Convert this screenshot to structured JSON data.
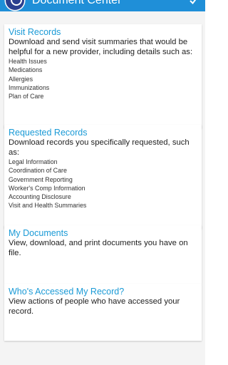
{
  "header": {
    "title": "Document Center",
    "logo_icon": "app-logo-icon",
    "action_icon": "check-icon",
    "background_color": "#1f8fd8"
  },
  "cards": [
    {
      "title": "Visit Records",
      "description": "Download and send visit summaries that would be helpful for a new provider, including details such as:",
      "items": [
        "Health Issues",
        "Medications",
        "Allergies",
        "Immunizations",
        "Plan of Care"
      ]
    },
    {
      "title": "Requested Records",
      "description": "Download records you specifically requested, such as:",
      "items": [
        "Legal Information",
        "Coordination of Care",
        "Government Reporting",
        "Worker's Comp Information",
        "Accounting Disclosure",
        "Visit and Health Summaries"
      ]
    },
    {
      "title": "My Documents",
      "description": "View, download, and print documents you have on file.",
      "items": []
    },
    {
      "title": "Who's Accessed My Record?",
      "description": "View actions of people who have accessed your record.",
      "items": []
    }
  ],
  "colors": {
    "accent_title": "#1a9ad6",
    "background": "#f4f4f4"
  }
}
